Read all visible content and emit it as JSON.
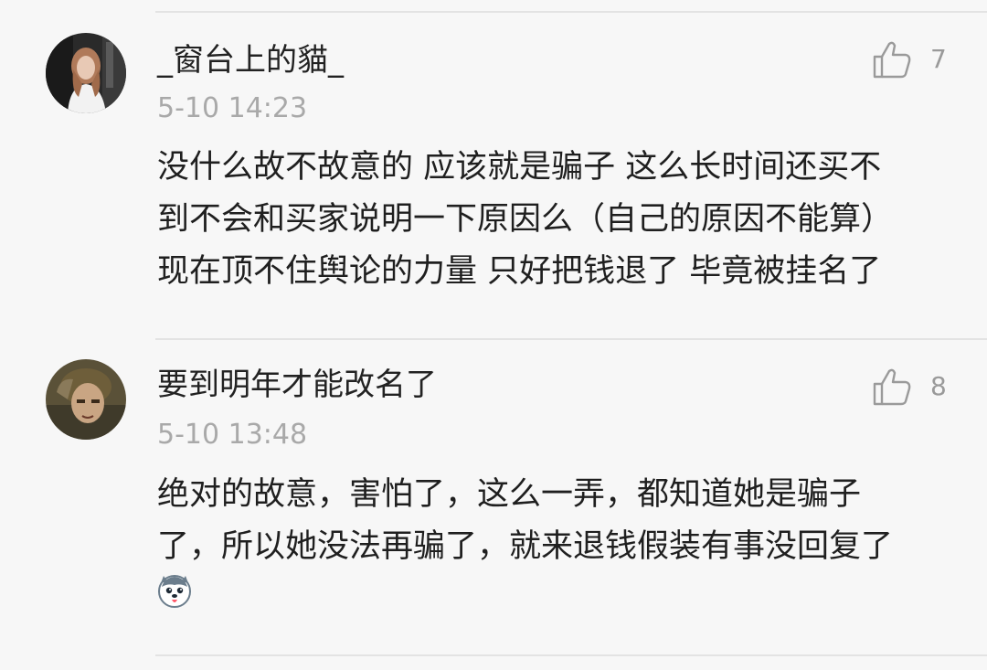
{
  "comments": [
    {
      "username": "_窗台上的貓_",
      "timestamp": "5-10 14:23",
      "likes": "7",
      "lines": [
        "没什么故不故意的 应该就是骗子 这么长时间还买不",
        "到不会和买家说明一下原因么（自己的原因不能算）",
        "现在顶不住舆论的力量 只好把钱退了 毕竟被挂名了"
      ],
      "avatar_icon": "avatar-girl-photo"
    },
    {
      "username": "要到明年才能改名了",
      "timestamp": "5-10 13:48",
      "likes": "8",
      "lines": [
        "绝对的故意，害怕了，这么一弄，都知道她是骗子",
        "了，所以她没法再骗了，就来退钱假装有事没回复了"
      ],
      "avatar_icon": "avatar-portrait-photo",
      "emoji_icon": "husky-dog-emoji"
    }
  ],
  "like_icon": "thumbs-up-outline-icon",
  "colors": {
    "background": "#f7f7f7",
    "username": "#222222",
    "timestamp": "#a9a9a9",
    "body": "#1f1f1f",
    "like": "#9a9a9a",
    "divider": "#e3e3e3"
  }
}
